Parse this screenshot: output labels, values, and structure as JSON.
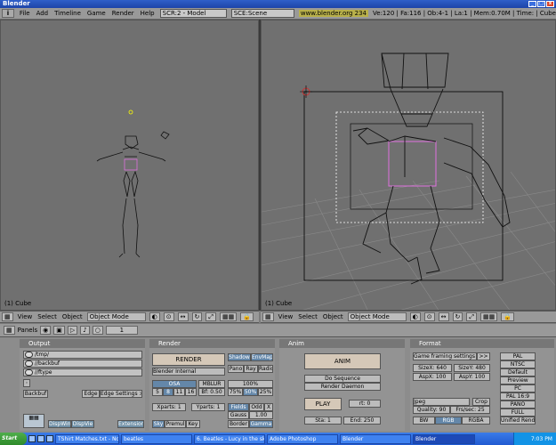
{
  "window": {
    "title": "Blender"
  },
  "infobar": {
    "info_icon": "i",
    "menus": [
      "File",
      "Add",
      "Timeline",
      "Game",
      "Render",
      "Help"
    ],
    "screen": "SCR:2 - Model",
    "scene": "SCE:Scene",
    "url": "www.blender.org 234",
    "stats": "Ve:120 | Fa:116 | Ob:4-1 | La:1 | Mem:0.70M | Time: | Cube"
  },
  "viewports": {
    "left_label": "(1) Cube",
    "right_label": "(1) Cube"
  },
  "view_header": {
    "menus": [
      "View",
      "Select",
      "Object"
    ],
    "mode": "Object Mode",
    "frame": "1"
  },
  "buttons_header": {
    "panels_label": "Panels",
    "frame": "1"
  },
  "output": {
    "title": "Output",
    "paths": [
      "/tmp/",
      "//backbuf",
      "//ftype"
    ],
    "backbuf": "Backbuf",
    "edge": "Edge",
    "edge_settings": "Edge Settings >>",
    "dispwin": "DispWin",
    "dispview": "DispVie",
    "extension": "Extension"
  },
  "render": {
    "title": "Render",
    "render_btn": "RENDER",
    "engine": "Blender Internal",
    "shadow": "Shadow",
    "envmap": "EnvMap",
    "pano": "Pano",
    "ray": "Ray",
    "radio": "Radio",
    "osa": "OSA",
    "mblur": "MBLUR",
    "osa_levels": [
      "5",
      "8",
      "11",
      "16"
    ],
    "bf": "Bf: 0.50",
    "pct100": "100%",
    "pct75": "75%",
    "pct50": "50%",
    "pct25": "25%",
    "xparts": "Xparts: 1",
    "yparts": "Yparts: 1",
    "fields": "Fields",
    "odd": "Odd",
    "x": "X",
    "gauss": "Gauss",
    "gauss_val": "1.00",
    "sky": "Sky",
    "premul": "Premul",
    "key": "Key",
    "border": "Border",
    "gamma": "Gamma"
  },
  "anim": {
    "title": "Anim",
    "anim_btn": "ANIM",
    "do_sequence": "Do Sequence",
    "render_daemon": "Render Daemon",
    "play": "PLAY",
    "rt": "rt: 0",
    "sta": "Sta: 1",
    "end": "End: 250"
  },
  "format": {
    "title": "Format",
    "game_framing": "Game framing settings",
    "game_framing_arrow": ">>",
    "sizex": "SizeX: 640",
    "sizey": "SizeY: 480",
    "aspx": "AspX: 100",
    "aspy": "AspY: 100",
    "codec": "Jpeg",
    "crop": "Crop",
    "quality": "Quality: 90",
    "fps": "Frs/sec: 25",
    "bw": "BW",
    "rgb": "RGB",
    "rgba": "RGBA",
    "presets": [
      "PAL",
      "NTSC",
      "Default",
      "Preview",
      "PC",
      "PAL 16:9",
      "PANO",
      "FULL",
      "Unified Rende"
    ]
  },
  "taskbar": {
    "start": "Start",
    "tasks": [
      "TShirt Matches.txt - Note...",
      "beatles",
      "6. Beatles - Lucy in the sk...",
      "Adobe Photoshop",
      "Blender",
      "Blender"
    ],
    "clock": "7:03 PM"
  },
  "colors": {
    "title_blue": "#1d44a8",
    "viewport_bg": "#707070",
    "panel_bg": "#939393",
    "selected_pink": "#e070e0",
    "taskbar_blue": "#215ad1"
  }
}
